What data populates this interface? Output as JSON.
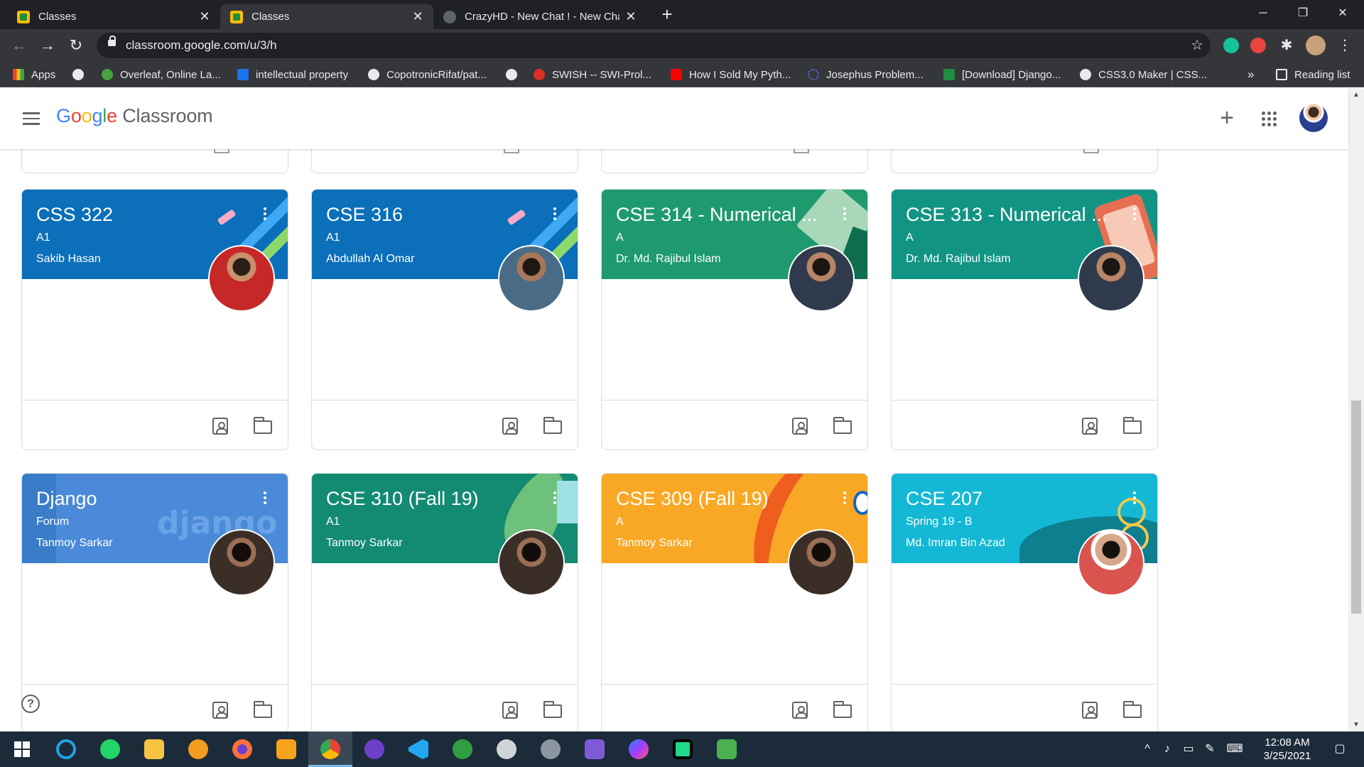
{
  "browser": {
    "tabs": [
      {
        "title": "Classes",
        "favicon": "classroom-icon",
        "active": false
      },
      {
        "title": "Classes",
        "favicon": "classroom-icon",
        "active": true
      },
      {
        "title": "CrazyHD - New Chat ! - New Cha",
        "favicon": "globe-icon",
        "active": false
      }
    ],
    "url": "classroom.google.com/u/3/h",
    "bookmarks": [
      {
        "label": "Apps",
        "color": "#ea4335"
      },
      {
        "label": "",
        "color": "#e8eaed"
      },
      {
        "label": "Overleaf, Online La...",
        "color": "#47a141"
      },
      {
        "label": "intellectual property",
        "color": "#1a73e8"
      },
      {
        "label": "CopotronicRifat/pat...",
        "color": "#e8eaed"
      },
      {
        "label": "",
        "color": "#e8eaed"
      },
      {
        "label": "SWISH -- SWI-Prol...",
        "color": "#d93025"
      },
      {
        "label": "How I Sold My Pyth...",
        "color": "#ff0000"
      },
      {
        "label": "Josephus Problem...",
        "color": "#5f6ff2"
      },
      {
        "label": "[Download] Django...",
        "color": "#1e8e3e"
      },
      {
        "label": "CSS3.0 Maker | CSS...",
        "color": "#e8eaed"
      }
    ],
    "bookmarks_overflow": "»",
    "reading_list": "Reading list"
  },
  "app": {
    "logo_google": [
      "G",
      "o",
      "o",
      "g",
      "l",
      "e"
    ],
    "logo_product": "Classroom"
  },
  "classes": [
    {
      "title": "CSS 322",
      "section": "A1",
      "teacher": "Sakib Hasan",
      "color": "#0b6fba",
      "theme": "school-supplies",
      "avatar_bg": "#c62828"
    },
    {
      "title": "CSE 316",
      "section": "A1",
      "teacher": "Abdullah Al Omar",
      "color": "#0b6fba",
      "theme": "school-supplies",
      "avatar_bg": "#4a6b85"
    },
    {
      "title": "CSE 314 - Numerical ...",
      "section": "A",
      "teacher": "Dr. Md. Rajibul Islam",
      "color": "#1e9a6e",
      "theme": "notebook",
      "avatar_bg": "#2f3b4c"
    },
    {
      "title": "CSE 313 - Numerical ...",
      "section": "A",
      "teacher": "Dr. Md. Rajibul Islam",
      "color": "#129484",
      "theme": "phone",
      "avatar_bg": "#2f3b4c"
    },
    {
      "title": "Django",
      "section": "Forum",
      "teacher": "Tanmoy Sarkar",
      "color": "#4a8ad8",
      "theme": "django",
      "avatar_bg": "#3b2e26"
    },
    {
      "title": "CSE 310 (Fall 19)",
      "section": "A1",
      "teacher": "Tanmoy Sarkar",
      "color": "#138a72",
      "theme": "leaves",
      "avatar_bg": "#3b2e26"
    },
    {
      "title": "CSE 309 (Fall 19)",
      "section": "A",
      "teacher": "Tanmoy Sarkar",
      "color": "#f9a825",
      "theme": "swoosh",
      "avatar_bg": "#3b2e26"
    },
    {
      "title": "CSE 207",
      "section": "Spring 19 - B",
      "teacher": "Md. Imran Bin Azad",
      "color": "#14b8d4",
      "theme": "bicycle",
      "avatar_bg": "#d9534f"
    }
  ],
  "help_label": "?",
  "taskbar": {
    "time": "12:08 AM",
    "date": "3/25/2021"
  }
}
